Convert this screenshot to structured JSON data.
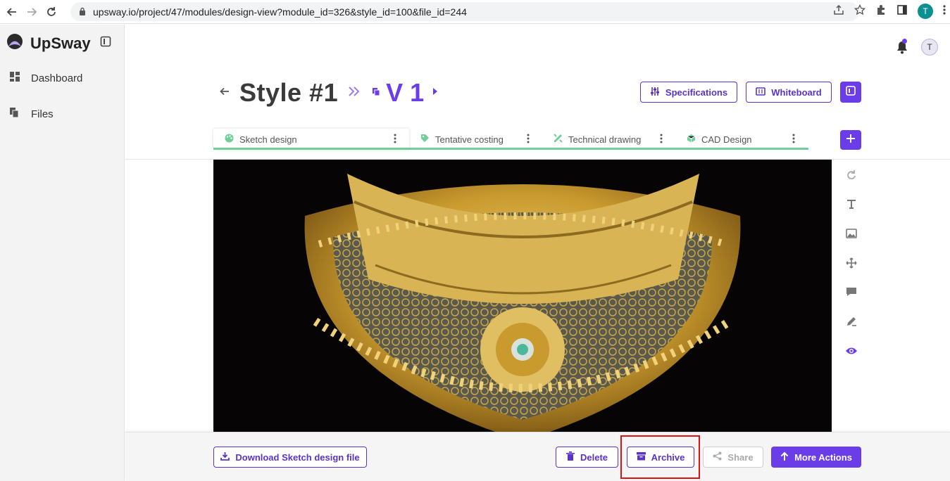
{
  "browser": {
    "url": "upsway.io/project/47/modules/design-view?module_id=326&style_id=100&file_id=244",
    "profile_initial": "T"
  },
  "sidebar": {
    "brand": "UpSway",
    "items": [
      {
        "label": "Dashboard",
        "icon": "dashboard-icon"
      },
      {
        "label": "Files",
        "icon": "files-icon"
      }
    ]
  },
  "header": {
    "user_initial": "T"
  },
  "page": {
    "title": "Style #1",
    "version": "V 1",
    "specifications_label": "Specifications",
    "whiteboard_label": "Whiteboard"
  },
  "tabs": [
    {
      "label": "Sketch design",
      "icon": "palette-icon",
      "active": true
    },
    {
      "label": "Tentative costing",
      "icon": "tag-icon",
      "active": false
    },
    {
      "label": "Technical drawing",
      "icon": "ruler-pencil-icon",
      "active": false
    },
    {
      "label": "CAD Design",
      "icon": "cube-icon",
      "active": false
    }
  ],
  "tools": [
    "rotate-icon",
    "text-icon",
    "image-icon",
    "move-icon",
    "comment-icon",
    "draw-icon",
    "eye-icon"
  ],
  "footer": {
    "download_label": "Download Sketch design file",
    "delete_label": "Delete",
    "archive_label": "Archive",
    "share_label": "Share",
    "more_actions_label": "More Actions"
  },
  "colors": {
    "accent": "#6a3de8",
    "tab_underline": "#6fcf97",
    "highlight": "#e01313",
    "image_background": "#060404"
  }
}
